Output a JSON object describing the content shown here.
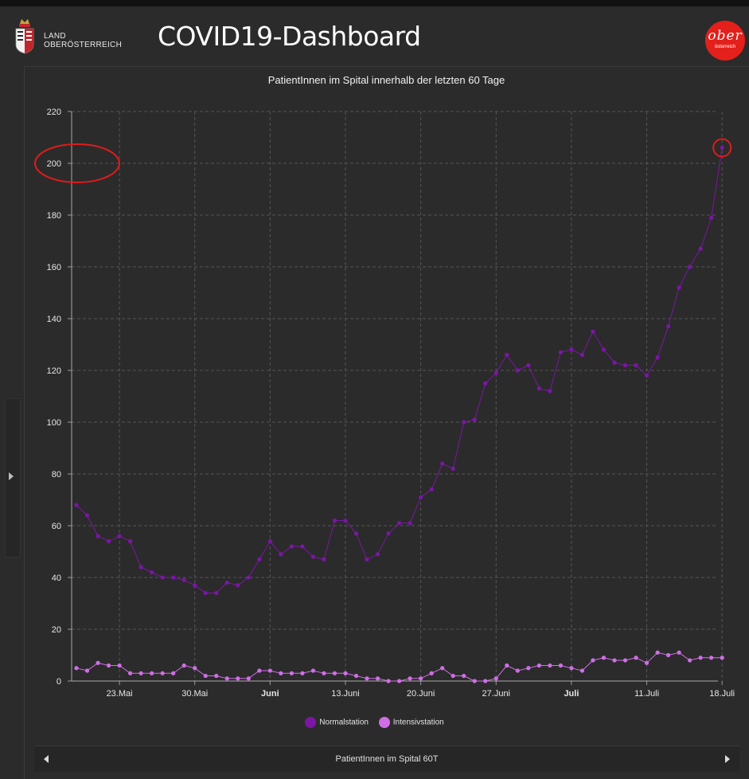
{
  "header": {
    "land_line1": "LAND",
    "land_line2": "OBERÖSTERREICH",
    "title": "COVID19-Dashboard",
    "logo_text": "ober",
    "logo_sub": "österreich"
  },
  "colors": {
    "normal": "#7b16a6",
    "intensiv": "#d06ee6",
    "annotation": "#e01b1b",
    "brand": "#e3201b"
  },
  "chart_data": {
    "type": "line",
    "title": "PatientInnen im Spital innerhalb der letzten 60 Tage",
    "ylim": [
      0,
      220
    ],
    "yticks": [
      0,
      20,
      40,
      60,
      80,
      100,
      120,
      140,
      160,
      180,
      200,
      220
    ],
    "xticks": [
      {
        "label": "23.Mai",
        "index": 4,
        "bold": false
      },
      {
        "label": "30.Mai",
        "index": 11,
        "bold": false
      },
      {
        "label": "Juni",
        "index": 18,
        "bold": true
      },
      {
        "label": "13.Juni",
        "index": 25,
        "bold": false
      },
      {
        "label": "20.Juni",
        "index": 32,
        "bold": false
      },
      {
        "label": "27.Juni",
        "index": 39,
        "bold": false
      },
      {
        "label": "Juli",
        "index": 46,
        "bold": true
      },
      {
        "label": "11.Juli",
        "index": 53,
        "bold": false
      },
      {
        "label": "18.Juli",
        "index": 60,
        "bold": false
      }
    ],
    "grid": true,
    "legend_position": "bottom",
    "series": [
      {
        "name": "Normalstation",
        "values": [
          68,
          64,
          56,
          54,
          56,
          54,
          44,
          42,
          40,
          40,
          39,
          37,
          34,
          34,
          38,
          37,
          40,
          47,
          54,
          49,
          52,
          52,
          48,
          47,
          62,
          62,
          57,
          47,
          49,
          57,
          61,
          61,
          71,
          74,
          84,
          82,
          100,
          101,
          115,
          119,
          126,
          120,
          122,
          113,
          112,
          127,
          128,
          126,
          135,
          128,
          123,
          122,
          122,
          118,
          125,
          137,
          152,
          160,
          167,
          179,
          206
        ]
      },
      {
        "name": "Intensivstation",
        "values": [
          5,
          4,
          7,
          6,
          6,
          3,
          3,
          3,
          3,
          3,
          6,
          5,
          2,
          2,
          1,
          1,
          1,
          4,
          4,
          3,
          3,
          3,
          4,
          3,
          3,
          3,
          2,
          1,
          1,
          0,
          0,
          1,
          1,
          3,
          5,
          2,
          2,
          0,
          0,
          1,
          6,
          4,
          5,
          6,
          6,
          6,
          5,
          4,
          8,
          9,
          8,
          8,
          9,
          7,
          11,
          10,
          11,
          8,
          9,
          9,
          9
        ]
      }
    ]
  },
  "bottom_nav": {
    "label": "PatientInnen im Spital 60T"
  }
}
